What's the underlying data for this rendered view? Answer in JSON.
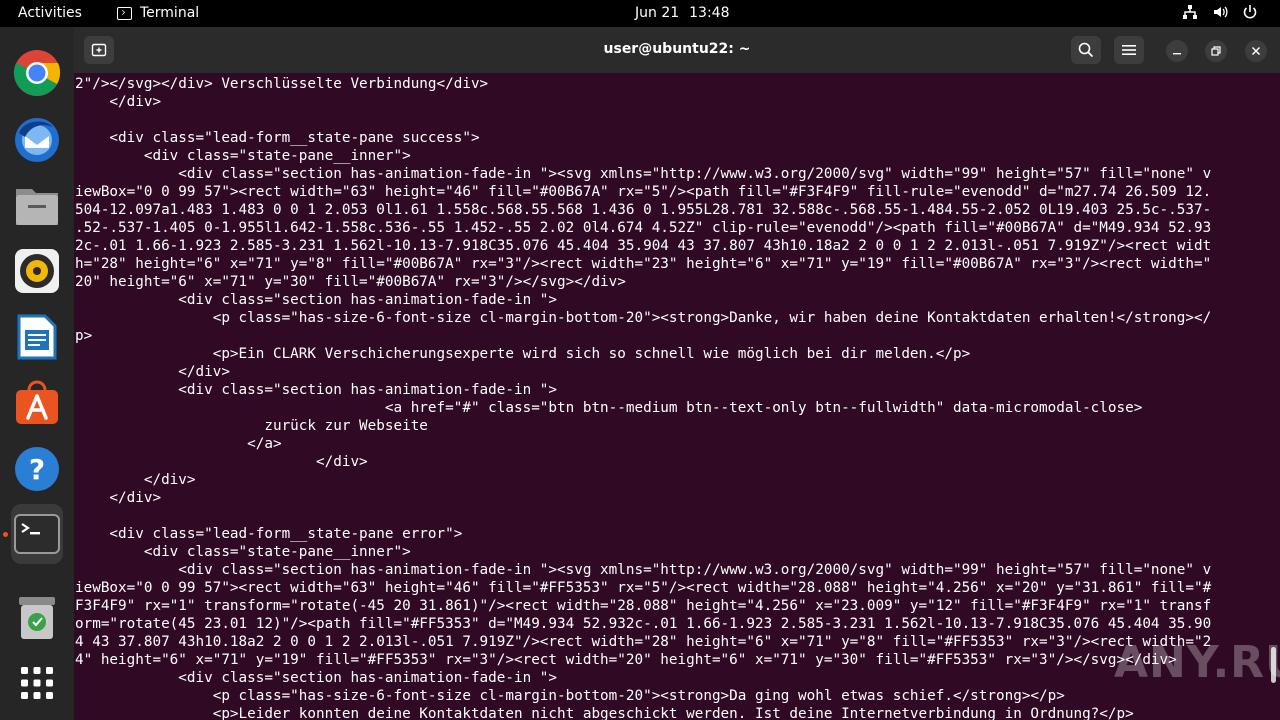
{
  "topbar": {
    "activities": "Activities",
    "app_name": "Terminal",
    "date": "Jun 21",
    "time": "13:48"
  },
  "dock": {
    "items": [
      {
        "name": "chrome-icon",
        "active": false
      },
      {
        "name": "thunderbird-icon",
        "active": false
      },
      {
        "name": "files-icon",
        "active": false
      },
      {
        "name": "rhythmbox-icon",
        "active": false
      },
      {
        "name": "writer-icon",
        "active": false
      },
      {
        "name": "app-center-icon",
        "active": false
      },
      {
        "name": "help-icon",
        "active": false
      },
      {
        "name": "terminal-icon",
        "active": true
      },
      {
        "name": "trash-icon",
        "active": false
      },
      {
        "name": "show-apps-icon",
        "active": false
      }
    ]
  },
  "window": {
    "title": "user@ubuntu22: ~"
  },
  "terminal": {
    "lines": [
      "2\"/></svg></div> Verschlüsselte Verbindung</div>",
      "    </div>",
      "",
      "    <div class=\"lead-form__state-pane success\">",
      "        <div class=\"state-pane__inner\">",
      "            <div class=\"section has-animation-fade-in \"><svg xmlns=\"http://www.w3.org/2000/svg\" width=\"99\" height=\"57\" fill=\"none\" v",
      "iewBox=\"0 0 99 57\"><rect width=\"63\" height=\"46\" fill=\"#00B67A\" rx=\"5\"/><path fill=\"#F3F4F9\" fill-rule=\"evenodd\" d=\"m27.74 26.509 12.",
      "504-12.097a1.483 1.483 0 0 1 2.053 0l1.61 1.558c.568.55.568 1.436 0 1.955L28.781 32.588c-.568.55-1.484.55-2.052 0L19.403 25.5c-.537-",
      ".52-.537-1.405 0-1.955l1.642-1.558c.536-.55 1.452-.55 2.02 0l4.674 4.52Z\" clip-rule=\"evenodd\"/><path fill=\"#00B67A\" d=\"M49.934 52.93",
      "2c-.01 1.66-1.923 2.585-3.231 1.562l-10.13-7.918C35.076 45.404 35.904 43 37.807 43h10.18a2 2 0 0 1 2 2.013l-.051 7.919Z\"/><rect widt",
      "h=\"28\" height=\"6\" x=\"71\" y=\"8\" fill=\"#00B67A\" rx=\"3\"/><rect width=\"23\" height=\"6\" x=\"71\" y=\"19\" fill=\"#00B67A\" rx=\"3\"/><rect width=\"",
      "20\" height=\"6\" x=\"71\" y=\"30\" fill=\"#00B67A\" rx=\"3\"/></svg></div>",
      "            <div class=\"section has-animation-fade-in \">",
      "                <p class=\"has-size-6-font-size cl-margin-bottom-20\"><strong>Danke, wir haben deine Kontaktdaten erhalten!</strong></",
      "p>",
      "                <p>Ein CLARK Verschicherungsexperte wird sich so schnell wie möglich bei dir melden.</p>",
      "            </div>",
      "            <div class=\"section has-animation-fade-in \">",
      "                                    <a href=\"#\" class=\"btn btn--medium btn--text-only btn--fullwidth\" data-micromodal-close>",
      "                      zurück zur Webseite",
      "                    </a>",
      "                            </div>",
      "        </div>",
      "    </div>",
      "",
      "    <div class=\"lead-form__state-pane error\">",
      "        <div class=\"state-pane__inner\">",
      "            <div class=\"section has-animation-fade-in \"><svg xmlns=\"http://www.w3.org/2000/svg\" width=\"99\" height=\"57\" fill=\"none\" v",
      "iewBox=\"0 0 99 57\"><rect width=\"63\" height=\"46\" fill=\"#FF5353\" rx=\"5\"/><rect width=\"28.088\" height=\"4.256\" x=\"20\" y=\"31.861\" fill=\"#",
      "F3F4F9\" rx=\"1\" transform=\"rotate(-45 20 31.861)\"/><rect width=\"28.088\" height=\"4.256\" x=\"23.009\" y=\"12\" fill=\"#F3F4F9\" rx=\"1\" transf",
      "orm=\"rotate(45 23.01 12)\"/><path fill=\"#FF5353\" d=\"M49.934 52.932c-.01 1.66-1.923 2.585-3.231 1.562l-10.13-7.918C35.076 45.404 35.90",
      "4 43 37.807 43h10.18a2 2 0 0 1 2 2.013l-.051 7.919Z\"/><rect width=\"28\" height=\"6\" x=\"71\" y=\"8\" fill=\"#FF5353\" rx=\"3\"/><rect width=\"2",
      "4\" height=\"6\" x=\"71\" y=\"19\" fill=\"#FF5353\" rx=\"3\"/><rect width=\"20\" height=\"6\" x=\"71\" y=\"30\" fill=\"#FF5353\" rx=\"3\"/></svg></div>",
      "            <div class=\"section has-animation-fade-in \">",
      "                <p class=\"has-size-6-font-size cl-margin-bottom-20\"><strong>Da ging wohl etwas schief.</strong></p>",
      "                <p>Leider konnten deine Kontaktdaten nicht abgeschickt werden. Ist deine Internetverbindung in Ordnung?</p>"
    ]
  },
  "watermark": "ANY.RUN"
}
